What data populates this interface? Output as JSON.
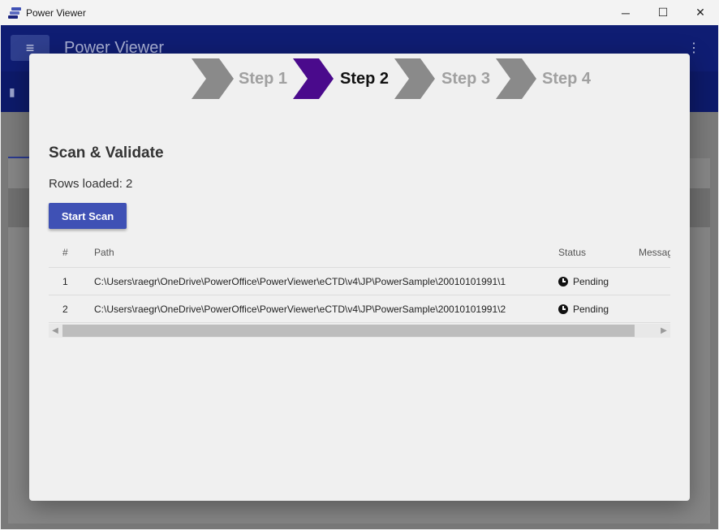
{
  "window": {
    "title": "Power Viewer",
    "controls": {
      "minimize": "─",
      "maximize": "☐",
      "close": "✕"
    }
  },
  "app": {
    "title": "Power Viewer",
    "menu_icon": "hamburger-icon",
    "more_icon": "kebab-icon",
    "accent": "#0f1d73"
  },
  "wizard": {
    "steps": [
      {
        "label": "Step 1",
        "active": false
      },
      {
        "label": "Step 2",
        "active": true
      },
      {
        "label": "Step 3",
        "active": false
      },
      {
        "label": "Step 4",
        "active": false
      }
    ],
    "active_color": "#4a0a8c",
    "inactive_color": "#8a8a8a",
    "heading": "Scan & Validate",
    "rows_loaded": "Rows loaded: 2",
    "start_button": "Start Scan",
    "table": {
      "columns": [
        "#",
        "Path",
        "Status",
        "Message"
      ],
      "rows": [
        {
          "num": "1",
          "path": "C:\\Users\\raegr\\OneDrive\\PowerOffice\\PowerViewer\\eCTD\\v4\\JP\\PowerSample\\20010101991\\1",
          "status": "Pending"
        },
        {
          "num": "2",
          "path": "C:\\Users\\raegr\\OneDrive\\PowerOffice\\PowerViewer\\eCTD\\v4\\JP\\PowerSample\\20010101991\\2",
          "status": "Pending"
        }
      ]
    }
  }
}
